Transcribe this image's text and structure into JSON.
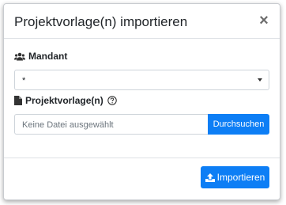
{
  "dialog": {
    "title": "Projektvorlage(n) importieren",
    "close_glyph": "×"
  },
  "mandant": {
    "label": "Mandant",
    "icon": "users-icon",
    "selected_value": "*"
  },
  "projektvorlage": {
    "label": "Projektvorlage(n)",
    "icon": "file-icon",
    "help_icon": "question-circle-icon",
    "file_placeholder": "Keine Datei ausgewählt",
    "browse_label": "Durchsuchen"
  },
  "footer": {
    "import_label": "Importieren",
    "import_icon": "upload-icon"
  },
  "colors": {
    "primary": "#0d7ef5",
    "border": "#ced4da",
    "text": "#212529",
    "muted": "#6c757d"
  }
}
